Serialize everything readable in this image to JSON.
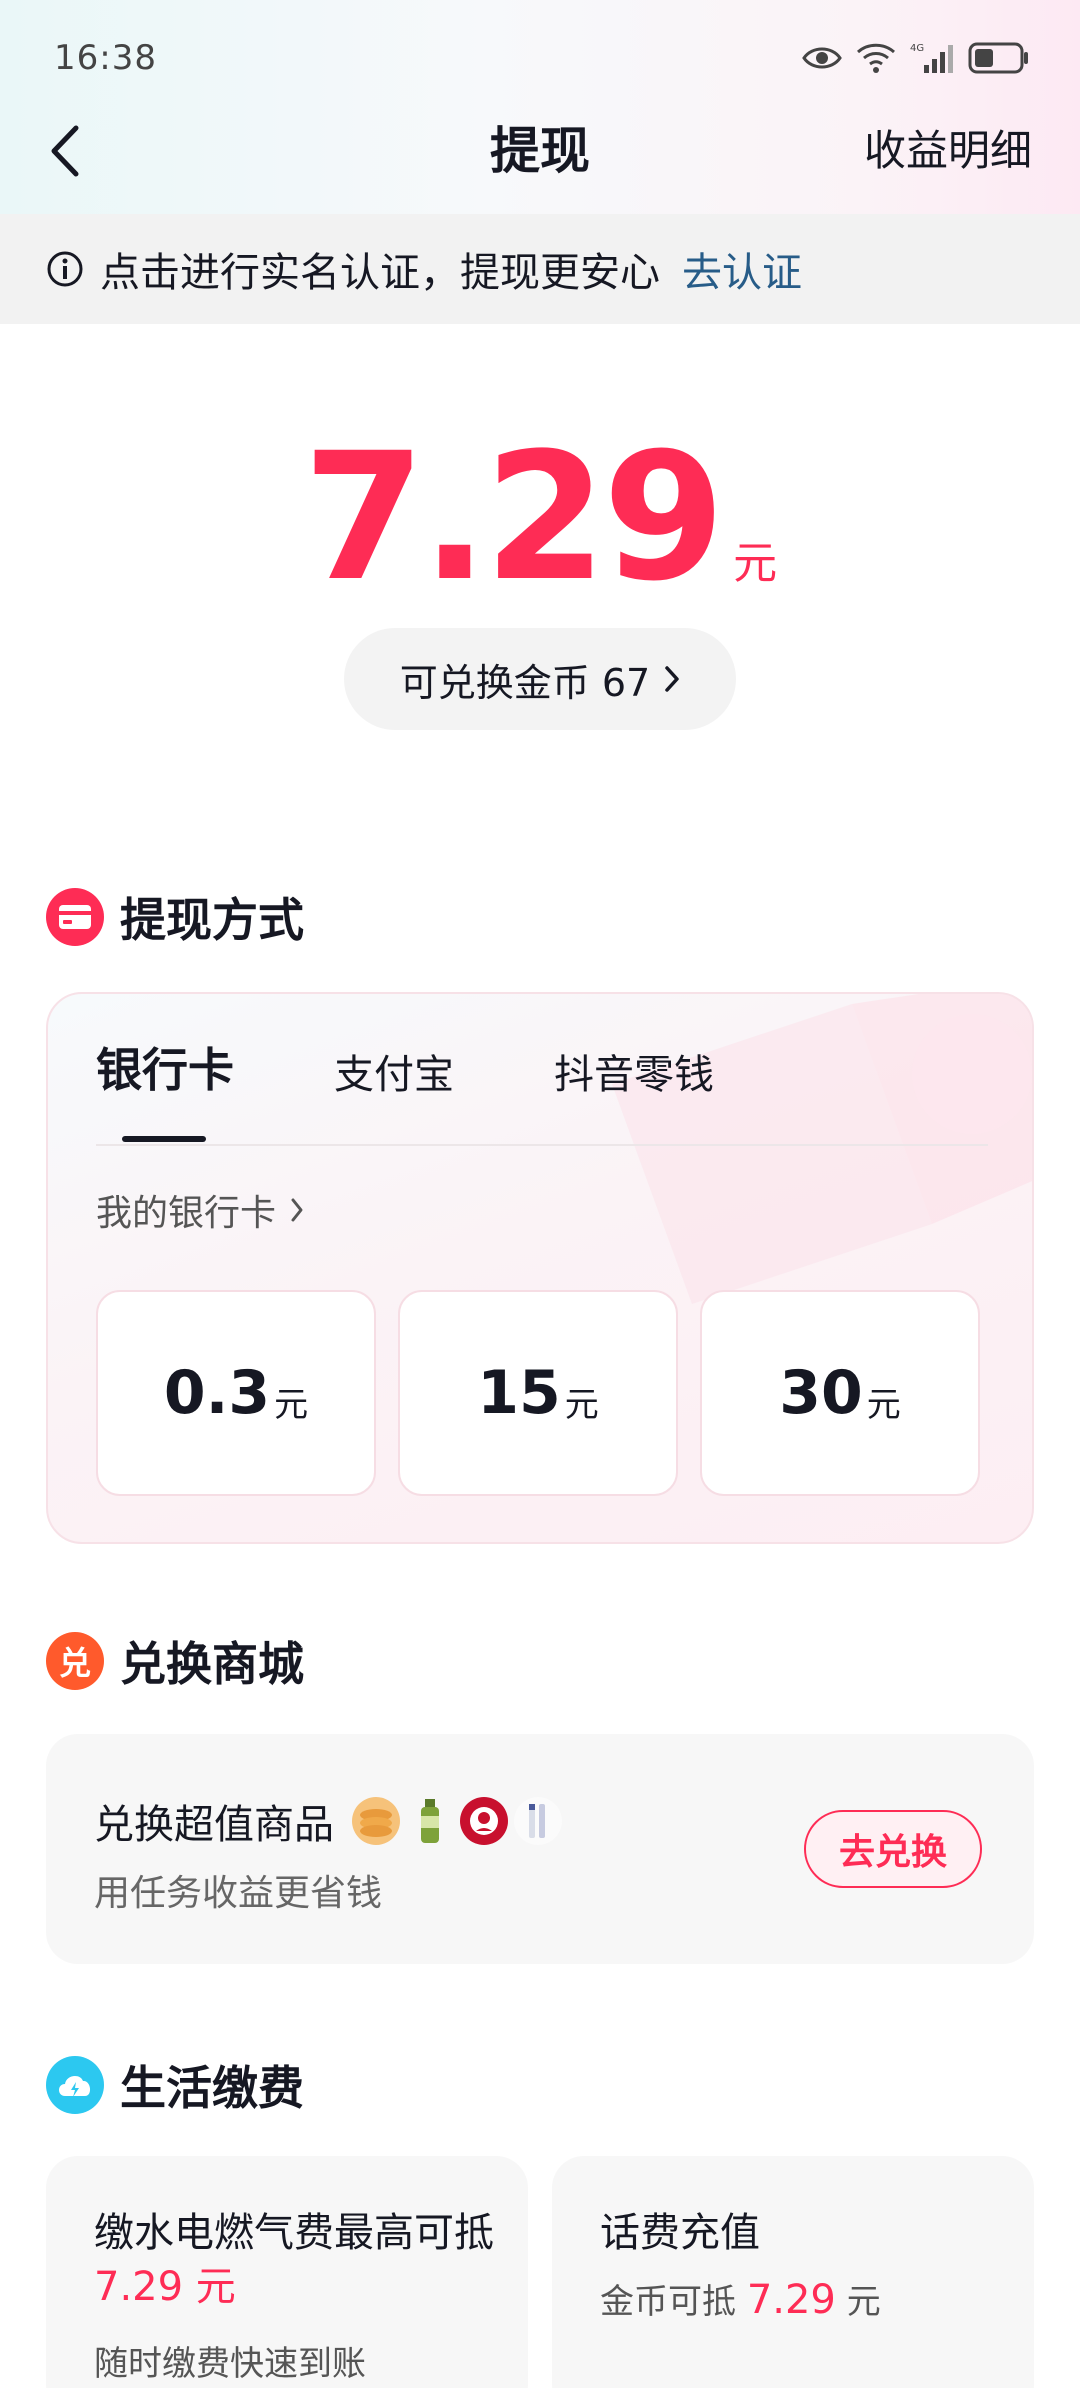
{
  "status_bar": {
    "time": "16:38",
    "network": "4G"
  },
  "nav": {
    "title": "提现",
    "right_link": "收益明细"
  },
  "notice": {
    "text": "点击进行实名认证，提现更安心",
    "link": "去认证"
  },
  "balance": {
    "amount": "7.29",
    "unit": "元"
  },
  "coins": {
    "label": "可兑换金币 67"
  },
  "withdraw": {
    "section_title": "提现方式",
    "tabs": [
      {
        "label": "银行卡",
        "active": true
      },
      {
        "label": "支付宝",
        "active": false
      },
      {
        "label": "抖音零钱",
        "active": false
      }
    ],
    "my_card_label": "我的银行卡",
    "amounts": [
      {
        "value": "0.3",
        "unit": "元"
      },
      {
        "value": "15",
        "unit": "元"
      },
      {
        "value": "30",
        "unit": "元"
      }
    ]
  },
  "mall": {
    "section_title": "兑换商城",
    "item_title": "兑换超值商品",
    "item_sub": "用任务收益更省钱",
    "button": "去兑换",
    "goods_icons": [
      "cookie-icon",
      "bottle-icon",
      "kfc-logo-icon",
      "pen-icon"
    ]
  },
  "bills": {
    "section_title": "生活缴费",
    "left": {
      "title": "缴水电燃气费最高可抵",
      "amount": "7.29 元",
      "sub": "随时缴费快速到账"
    },
    "right": {
      "title": "话费充值",
      "sub_prefix": "金币可抵",
      "amount": "7.29",
      "unit": "元"
    }
  },
  "colors": {
    "accent": "#fe2c55",
    "link": "#275c88",
    "text": "#161823"
  }
}
